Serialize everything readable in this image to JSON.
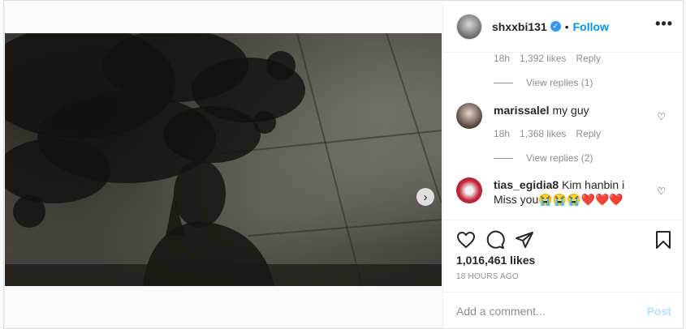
{
  "post": {
    "username": "shxxbi131",
    "follow_label": "Follow",
    "separator": "•",
    "more_label": "•••",
    "carousel_next_glyph": "›"
  },
  "comments": [
    {
      "type": "meta",
      "age": "18h",
      "likes": "1,392 likes",
      "reply_label": "Reply"
    },
    {
      "type": "view_replies",
      "label": "View replies (1)"
    },
    {
      "type": "comment",
      "username": "marissalel",
      "text": "my guy",
      "age": "18h",
      "likes": "1,368 likes",
      "reply_label": "Reply"
    },
    {
      "type": "view_replies",
      "label": "View replies (2)"
    },
    {
      "type": "comment",
      "username": "tias_egidia8",
      "text": "Kim hanbin i Miss you😭😭😭❤️❤️❤️"
    }
  ],
  "actions": {
    "likes": "1,016,461 likes",
    "time": "18 HOURS AGO",
    "comment_placeholder": "Add a comment...",
    "post_label": "Post"
  },
  "icons": {
    "like": "heart-icon",
    "comment": "comment-icon",
    "share": "share-icon",
    "save": "bookmark-icon",
    "comment_like": "small-heart-icon"
  },
  "colors": {
    "accent": "#0095f6",
    "verified": "#3897f0",
    "post_disabled": "#b2dffc",
    "muted": "#8e8e8e"
  }
}
